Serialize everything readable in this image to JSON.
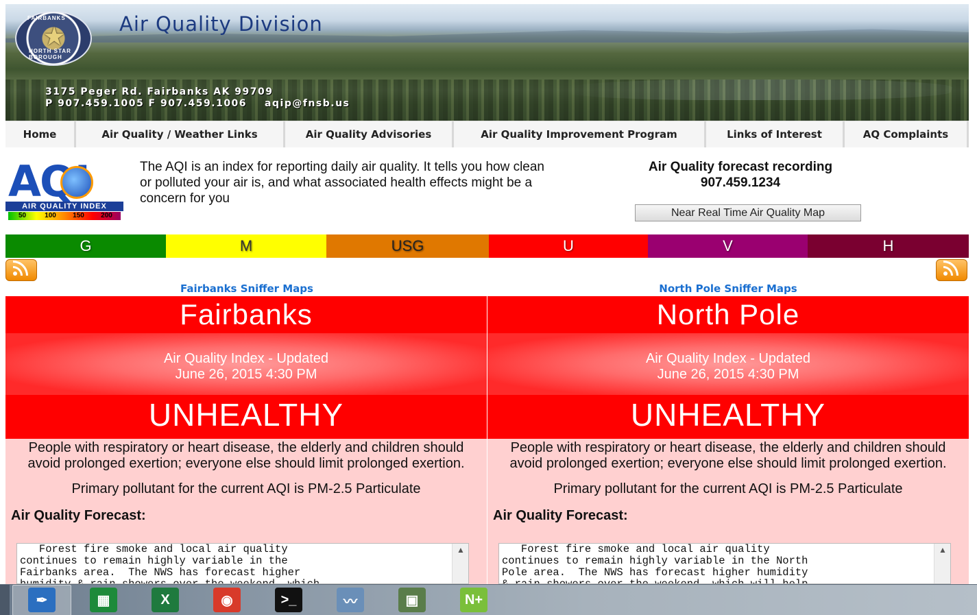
{
  "header": {
    "title": "Air Quality Division",
    "address": "3175 Peger Rd. Fairbanks AK 99709",
    "phone": "P 907.459.1005 F 907.459.1006",
    "email": "aqip@fnsb.us",
    "logo_ring_top": "FAIRBANKS",
    "logo_ring_bottom": "NORTH STAR BOROUGH"
  },
  "nav": [
    {
      "label": "Home",
      "width": 103
    },
    {
      "label": "Air Quality / Weather Links",
      "width": 305
    },
    {
      "label": "Air Quality Advisories",
      "width": 246
    },
    {
      "label": "Air Quality Improvement Program",
      "width": 368
    },
    {
      "label": "Links of Interest",
      "width": 202
    },
    {
      "label": "AQ Complaints",
      "width": 181
    }
  ],
  "aqi": {
    "logo_letters": "AQI",
    "logo_band": "AIR QUALITY INDEX",
    "scale": [
      "50",
      "100",
      "150",
      "200"
    ],
    "scale_colors": [
      "#00c000",
      "#ffff00",
      "#ff8800",
      "#ff0000",
      "#9a0060"
    ],
    "description": "The AQI is an index for reporting daily air quality. It tells you how clean or polluted your air is, and what associated health effects might be a concern for you"
  },
  "forecast_recording": {
    "label": "Air Quality forecast recording",
    "phone": "907.459.1234",
    "map_button": "Near Real Time Air Quality Map"
  },
  "categories": [
    {
      "label": "G",
      "color": "#0a8a00",
      "text": "#ffffff"
    },
    {
      "label": "M",
      "color": "#ffff00",
      "text": "#333333"
    },
    {
      "label": "USG",
      "color": "#e07800",
      "text": "#222222"
    },
    {
      "label": "U",
      "color": "#ff0000",
      "text": "#ffffff"
    },
    {
      "label": "V",
      "color": "#9a0070",
      "text": "#ffffff"
    },
    {
      "label": "H",
      "color": "#7a0030",
      "text": "#ffffff"
    }
  ],
  "sniffer_links": {
    "left": "Fairbanks Sniffer Maps",
    "right": "North Pole Sniffer Maps"
  },
  "stations": [
    {
      "name": "Fairbanks",
      "updated_label": "Air Quality Index - Updated",
      "updated_time": "June 26, 2015 4:30 PM",
      "status": "UNHEALTHY",
      "health": "People with respiratory or heart disease, the elderly and children should avoid prolonged exertion; everyone else should limit prolonged exertion.",
      "pollutant": "Primary pollutant for the current AQI is PM-2.5 Particulate",
      "forecast_label": "Air Quality Forecast:",
      "forecast_text": "   Forest fire smoke and local air quality\ncontinues to remain highly variable in the\nFairbanks area.  The NWS has forecast higher\nhumidity & rain showers over the weekend, which"
    },
    {
      "name": "North Pole",
      "updated_label": "Air Quality Index - Updated",
      "updated_time": "June 26, 2015 4:30 PM",
      "status": "UNHEALTHY",
      "health": "People with respiratory or heart disease, the elderly and children should avoid prolonged exertion; everyone else should limit prolonged exertion.",
      "pollutant": "Primary pollutant for the current AQI is PM-2.5 Particulate",
      "forecast_label": "Air Quality Forecast:",
      "forecast_text": "   Forest fire smoke and local air quality\ncontinues to remain highly variable in the North\nPole area.  The NWS has forecast higher humidity\n& rain showers over the weekend, which will help"
    }
  ],
  "taskbar": [
    {
      "icon": "pen-tool-icon",
      "color": "#2b6fc0",
      "glyph": "✒",
      "active": true
    },
    {
      "icon": "spreadsheet-icon",
      "color": "#1d8a3a",
      "glyph": "▦",
      "active": false
    },
    {
      "icon": "excel-icon",
      "color": "#1f7a3e",
      "glyph": "X",
      "active": false
    },
    {
      "icon": "chrome-icon",
      "color": "#d83a2a",
      "glyph": "◉",
      "active": false
    },
    {
      "icon": "terminal-icon",
      "color": "#111111",
      "glyph": ">_",
      "active": false
    },
    {
      "icon": "performance-monitor-icon",
      "color": "#6a8fb8",
      "glyph": "〰",
      "active": false
    },
    {
      "icon": "image-viewer-icon",
      "color": "#5a7d4a",
      "glyph": "▣",
      "active": false
    },
    {
      "icon": "notepad-plus-icon",
      "color": "#7abf3a",
      "glyph": "N+",
      "active": false
    }
  ]
}
